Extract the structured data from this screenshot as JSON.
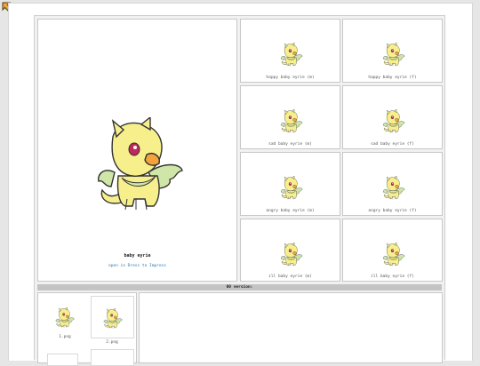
{
  "pet": {
    "name": "baby eyrie",
    "link": "open in Dress to Impress"
  },
  "colors": {
    "body": "#f6ef8c",
    "wing": "#cfe6a8",
    "beak": "#f4a23a",
    "eye": "#c2265a",
    "link": "#2b78b5"
  },
  "icons": {
    "back": "arrow-up-left-icon"
  },
  "variants": [
    {
      "label": "happy baby eyrie (m)"
    },
    {
      "label": "happy baby eyrie (f)"
    },
    {
      "label": "sad baby eyrie (m)"
    },
    {
      "label": "sad baby eyrie (f)"
    },
    {
      "label": "angry baby eyrie (m)"
    },
    {
      "label": "angry baby eyrie (f)"
    },
    {
      "label": "ill baby eyrie (m)"
    },
    {
      "label": "ill baby eyrie (f)"
    }
  ],
  "section_bar": {
    "label": "00 version:"
  },
  "images": [
    {
      "label": "1.png"
    },
    {
      "label": "2.png"
    }
  ]
}
